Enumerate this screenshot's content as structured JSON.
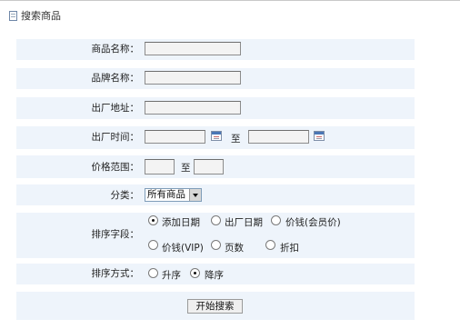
{
  "header": {
    "title": "搜索商品",
    "icon": "document-icon"
  },
  "form": {
    "product_name": {
      "label": "商品名称：",
      "value": ""
    },
    "brand_name": {
      "label": "品牌名称：",
      "value": ""
    },
    "factory_address": {
      "label": "出厂地址：",
      "value": ""
    },
    "factory_time": {
      "label": "出厂时间：",
      "from": "",
      "to": "",
      "separator": "至"
    },
    "price_range": {
      "label": "价格范围：",
      "from": "",
      "to": "",
      "separator": "至"
    },
    "category": {
      "label": "分类：",
      "selected": "所有商品"
    },
    "sort_field": {
      "label": "排序字段：",
      "options": [
        "添加日期",
        "出厂日期",
        "价钱(会员价)",
        "价钱(VIP)",
        "页数",
        "折扣"
      ],
      "selected": "添加日期"
    },
    "sort_order": {
      "label": "排序方式：",
      "options": [
        "升序",
        "降序"
      ],
      "selected": "降序"
    },
    "submit_label": "开始搜索"
  },
  "colors": {
    "row_bg": "#eef4fb",
    "input_bg": "#f3f3f3"
  }
}
